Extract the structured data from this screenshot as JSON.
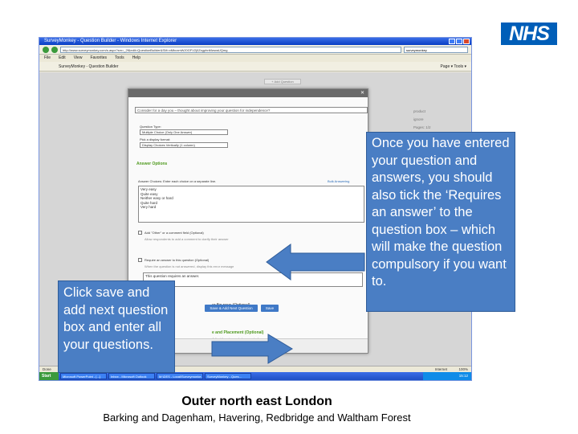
{
  "logo": {
    "text": "NHS"
  },
  "browser": {
    "title": "SurveyMonkey - Question Builder - Windows Internet Explorer",
    "url": "http://www.surveymonkey.com/s.aspx?sm=_2f&edit=QuestionBuilder&SM=xMbcxmWJ0GFV2j0ZxgphnMwwaUQmg",
    "search_text": "surveymonkey",
    "menu": [
      "File",
      "Edit",
      "View",
      "Favorites",
      "Tools",
      "Help"
    ],
    "tab_label": "SurveyMonkey - Question Builder",
    "tools_label": "Page  ▾  Tools  ▾",
    "add_question_label": "+ Add Question",
    "status_left": "Done",
    "status_zone": "Internet",
    "status_zoom": "100%",
    "clock": "15:12",
    "start_label": "Start",
    "tasks": [
      "Microsoft PowerPoint - [...]",
      "Inbox - Microsoft Outlook",
      "M:\\DES - Local\\Surveymonke...",
      "SurveyMonkey - Ques..."
    ]
  },
  "modal": {
    "question_text": "Consider for a day you – thought about improving your question for independence?",
    "question_type_label": "Question Type:",
    "question_type_value": "Multiple Choice (Only One Answer)",
    "display_label": "Pick a display format:",
    "display_value": "Display Choices Vertically (1 column)",
    "answer_options_heading": "Answer Options",
    "answer_choices_label": "Answer Choices: Enter each choice on a separate line.",
    "bulk_label": "Bulk Answering",
    "choices": [
      "Very easy",
      "Quite easy",
      "Neither easy or hard",
      "Quite hard",
      "Very hard"
    ],
    "other_label": "Add \"Other\" or a comment field (Optional)",
    "other_desc": "Allow respondents to add a comment to clarify their answer",
    "require_label": "Require an answer to this question (Optional)",
    "require_desc": "When the question is not answered, display this error message",
    "error_message": "This question requires an answer.",
    "skip_label": "or flip rows (Optional)",
    "placement_label": "e and Placement (Optional)",
    "placement_desc": "Adjust the size and placement of your question",
    "save_add_label": "Save & Add Next Question",
    "save_label": "Save"
  },
  "side_labels": [
    "product",
    "ignore",
    "Pages: 1/2",
    "Edit Page"
  ],
  "callouts": {
    "right": "Once you have entered your question and answers, you should also tick the ‘Requires an answer’ to the question box – which will make the question compulsory if you want to.",
    "left": "Click save and add next question box and enter all your questions."
  },
  "footer": {
    "title": "Outer north east London",
    "subtitle": "Barking and Dagenham, Havering, Redbridge and Waltham Forest"
  },
  "colors": {
    "callout_fill": "#4a7ec4",
    "arrow_fill": "#4a7ec4",
    "nhs_blue": "#005eb8",
    "accent_green": "#4f9a1e"
  }
}
